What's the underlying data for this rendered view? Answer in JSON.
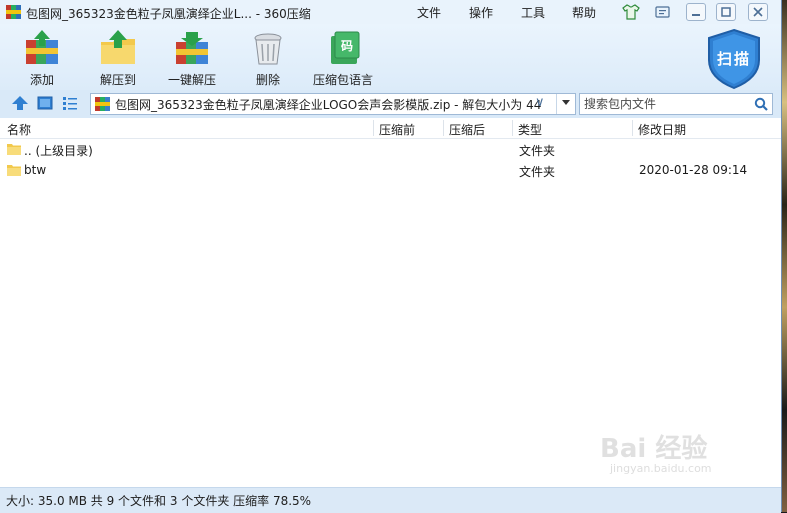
{
  "window": {
    "title": "包图网_365323金色粒子凤凰演绎企业L... - 360压缩"
  },
  "menu": {
    "items": [
      "文件",
      "操作",
      "工具",
      "帮助"
    ]
  },
  "toolbar": {
    "add_label": "添加",
    "extract_to_label": "解压到",
    "one_click_label": "一键解压",
    "delete_label": "删除",
    "language_label": "压缩包语言",
    "scan_label": "扫描"
  },
  "address": {
    "path": "包图网_365323金色粒子凤凰演绎企业LOGO会声会影模版.zip - 解包大小为 44"
  },
  "search": {
    "placeholder": "搜索包内文件"
  },
  "columns": {
    "name": "名称",
    "before": "压缩前",
    "after": "压缩后",
    "type": "类型",
    "modified": "修改日期"
  },
  "rows": [
    {
      "name": ".. (上级目录)",
      "type": "文件夹",
      "date": ""
    },
    {
      "name": "btw",
      "type": "文件夹",
      "date": "2020-01-28 09:14"
    }
  ],
  "status": {
    "text": "大小: 35.0 MB 共 9 个文件和 3 个文件夹 压缩率 78.5%"
  },
  "watermark": {
    "text": "Bai 经验",
    "sub": "jingyan.baidu.com"
  },
  "colors": {
    "accent": "#2f7fd1",
    "toolbar_bg": "#dcebf9",
    "folder": "#f7d46b"
  }
}
